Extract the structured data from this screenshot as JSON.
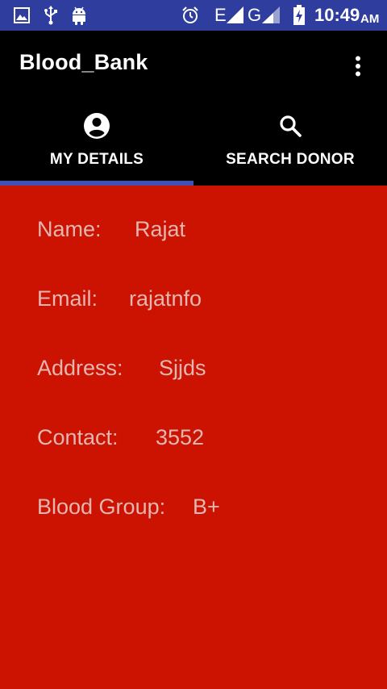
{
  "status_bar": {
    "left_icons": [
      "image-icon",
      "usb-icon",
      "android-icon"
    ],
    "right_icons": [
      "alarm-icon",
      "signal-icon",
      "signal-icon",
      "battery-charging-icon"
    ],
    "network_1": "E",
    "network_2": "G",
    "time": "10:49",
    "ampm": "AM"
  },
  "app_bar": {
    "title": "Blood_Bank",
    "overflow_icon": "more-vert-icon"
  },
  "tabs": [
    {
      "label": "MY DETAILS",
      "icon": "account-circle-icon",
      "selected": true
    },
    {
      "label": "SEARCH DONOR",
      "icon": "search-icon",
      "selected": false
    }
  ],
  "details": {
    "name_label": "Name:",
    "name_value": "Rajat",
    "email_label": "Email:",
    "email_value": "rajatnfo",
    "address_label": "Address:",
    "address_value": "Sjjds",
    "contact_label": "Contact:",
    "contact_value": "3552",
    "blood_group_label": "Blood Group:",
    "blood_group_value": "B+"
  },
  "colors": {
    "status_bar": "#2f3d9e",
    "app_bar": "#000000",
    "tab_indicator": "#3f51b5",
    "content_bg": "#cc1200",
    "detail_text": "#e2b7b2"
  }
}
